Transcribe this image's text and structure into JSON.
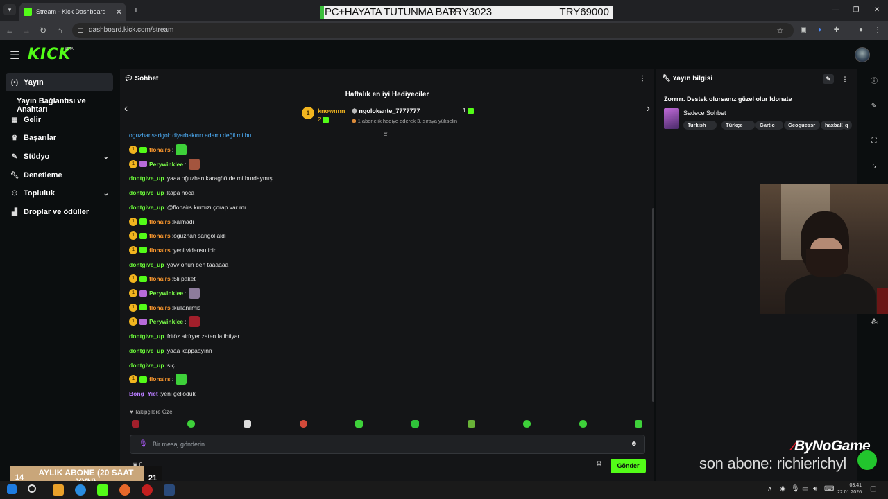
{
  "browser": {
    "tab_title": "Stream - Kick Dashboard",
    "url": "dashboard.kick.com/stream"
  },
  "ticker": {
    "text": "PC+HAYATA TUTUNMA BAR",
    "middle": "TRY3023",
    "right": "TRY69000"
  },
  "app": {
    "logo": "KICK",
    "beta": "BETA"
  },
  "sidebar": {
    "items": [
      {
        "label": "Yayın",
        "icon": "broadcast-icon",
        "active": true
      },
      {
        "label": "Gelir",
        "icon": "chart-icon"
      },
      {
        "label": "Başarılar",
        "icon": "trophy-icon"
      },
      {
        "label": "Stüdyo",
        "icon": "brush-icon"
      },
      {
        "label": "Denetleme",
        "icon": "wrench-icon"
      },
      {
        "label": "Topluluk",
        "icon": "people-icon"
      },
      {
        "label": "Droplar ve ödüller",
        "icon": "gift-icon"
      }
    ],
    "subitem": "Yayın Bağlantısı ve Anahtarı"
  },
  "chat": {
    "title": "Sohbet",
    "gifters_title": "Haftalık en iyi Hediyeciler",
    "gifter1": {
      "rank": "1",
      "name": "knownnn",
      "count": "2"
    },
    "gifter2": {
      "name": "ngolokante_7777777",
      "count": "1",
      "hint": "1 abonelik hediye ederek 3. sıraya yükselin"
    },
    "partial_top": "oguzhansarigol: diyarbakırın adamı değil mi bu",
    "messages": [
      {
        "user": "flonairs",
        "text": "",
        "badge": true,
        "sub": "green",
        "emote": "#3ed13a"
      },
      {
        "user": "Perywinklee",
        "text": "",
        "badge": true,
        "sub": "purple",
        "emote": "#a4553e"
      },
      {
        "user": "dontgive_up",
        "text": "yaaa oğuzhan karagöö de mi burdaymış"
      },
      {
        "user": "dontgive_up",
        "text": "kapa hoca"
      },
      {
        "user": "dontgive_up",
        "text": "@flonairs kırmızı çorap var mı"
      },
      {
        "user": "flonairs",
        "text": "kalmadi",
        "badge": true,
        "sub": "green"
      },
      {
        "user": "flonairs",
        "text": "oguzhan sarigol aldi",
        "badge": true,
        "sub": "green"
      },
      {
        "user": "flonairs",
        "text": "yeni videosu icin",
        "badge": true,
        "sub": "green"
      },
      {
        "user": "dontgive_up",
        "text": "yavv onun ben taaaaaa"
      },
      {
        "user": "flonairs",
        "text": "5li paket",
        "badge": true,
        "sub": "green"
      },
      {
        "user": "Perywinklee",
        "text": "",
        "badge": true,
        "sub": "purple",
        "emote": "#8d7c9c"
      },
      {
        "user": "flonairs",
        "text": "kullanilmis",
        "badge": true,
        "sub": "green"
      },
      {
        "user": "Perywinklee",
        "text": "",
        "badge": true,
        "sub": "purple",
        "emote": "#a11f2b"
      },
      {
        "user": "dontgive_up",
        "text": "fritöz airfryer zaten la ihtiyar"
      },
      {
        "user": "dontgive_up",
        "text": "yaaa kappaayınn"
      },
      {
        "user": "dontgive_up",
        "text": "sıç"
      },
      {
        "user": "flonairs",
        "text": "",
        "badge": true,
        "sub": "green",
        "emote": "#3ed13a"
      },
      {
        "user": "Bong_Yiet",
        "text": "yeni gelioduk",
        "color": "#b87cff"
      }
    ],
    "followers_label": "Takipçilere Özel",
    "input_placeholder": "Bir mesaj gönderin",
    "send_label": "Gönder",
    "sub_count": "0"
  },
  "info": {
    "title": "Yayın bilgisi",
    "stream_title": "Zorrrrr. Destek olursanız güzel olur !donate",
    "category": "Sadece Sohbet",
    "tags": [
      "Turkish",
      "Türkçe",
      "Gartic",
      "Geoguessr",
      "haxball",
      "q"
    ]
  },
  "overlay": {
    "last_sub": "son abone: richierichyl",
    "brand": "ByNoGame",
    "goal_label": "AYLIK ABONE (20 SAAT YYN)",
    "goal_current": "14",
    "goal_target": "21"
  },
  "taskbar": {
    "time": "03:41",
    "date": "22.01.2026"
  },
  "colors": {
    "kick_green": "#53fc18",
    "flonairs": "#ff9a2e",
    "dontgive_up": "#6dff3a",
    "perywinklee": "#7dff4a"
  }
}
